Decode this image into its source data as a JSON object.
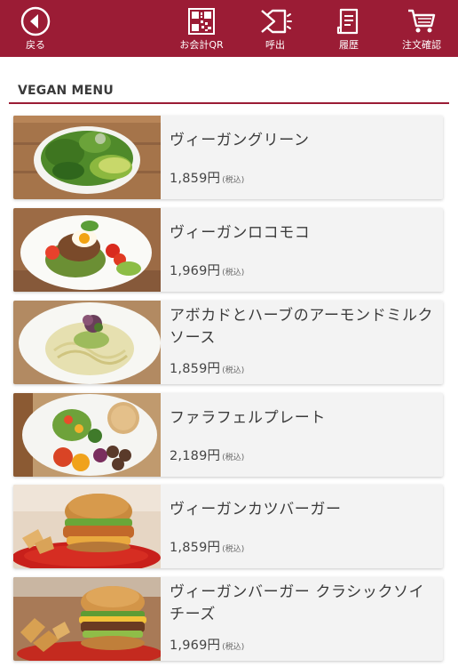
{
  "header": {
    "back_label": "戻る",
    "qr_label": "お会計QR",
    "call_label": "呼出",
    "history_label": "履歴",
    "cart_label": "注文確認"
  },
  "section": {
    "title": "VEGAN MENU"
  },
  "items": [
    {
      "name": "ヴィーガングリーン",
      "price": "1,859円",
      "tax": "(税込)"
    },
    {
      "name": "ヴィーガンロコモコ",
      "price": "1,969円",
      "tax": "(税込)"
    },
    {
      "name": "アボカドとハーブのアーモンドミルクソース",
      "price": "1,859円",
      "tax": "(税込)"
    },
    {
      "name": "ファラフェルプレート",
      "price": "2,189円",
      "tax": "(税込)"
    },
    {
      "name": "ヴィーガンカツバーガー",
      "price": "1,859円",
      "tax": "(税込)"
    },
    {
      "name": "ヴィーガンバーガー クラシックソイチーズ",
      "price": "1,969円",
      "tax": "(税込)"
    }
  ],
  "colors": {
    "brand": "#9b1c35",
    "card": "#f3f3f3",
    "text": "#3b3b3b"
  },
  "icons": [
    "back-arrow-icon",
    "qr-code-icon",
    "call-bell-icon",
    "history-receipt-icon",
    "cart-icon"
  ]
}
